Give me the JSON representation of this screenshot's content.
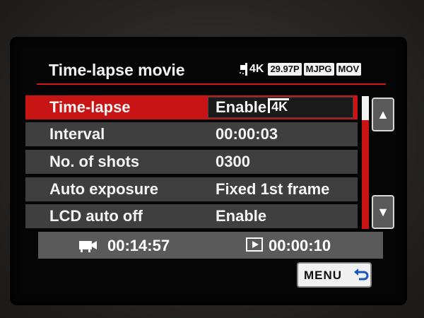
{
  "header": {
    "title": "Time-lapse movie",
    "title_icon": "timelapse-camera-icon",
    "badges": [
      "4K",
      "29.97P",
      "MJPG",
      "MOV"
    ]
  },
  "menu": {
    "items": [
      {
        "label": "Time-lapse",
        "value": "Enable",
        "value_badge": "4K",
        "selected": true
      },
      {
        "label": "Interval",
        "value": "00:00:03"
      },
      {
        "label": "No. of shots",
        "value": "0300"
      },
      {
        "label": "Auto exposure",
        "value": "Fixed 1st frame"
      },
      {
        "label": "LCD auto off",
        "value": "Enable"
      }
    ],
    "scroll_up_icon": "triangle-up-icon",
    "scroll_down_icon": "triangle-down-icon"
  },
  "status": {
    "record_icon": "movie-camera-icon",
    "record_time": "00:14:57",
    "playback_icon": "playback-icon",
    "playback_time": "00:00:10"
  },
  "footer": {
    "menu_label": "MENU",
    "return_icon": "return-arrow-icon"
  },
  "colors": {
    "accent_red": "#c81414",
    "row_bg": "#3f3f3f",
    "status_bg": "#5a5a5a"
  }
}
